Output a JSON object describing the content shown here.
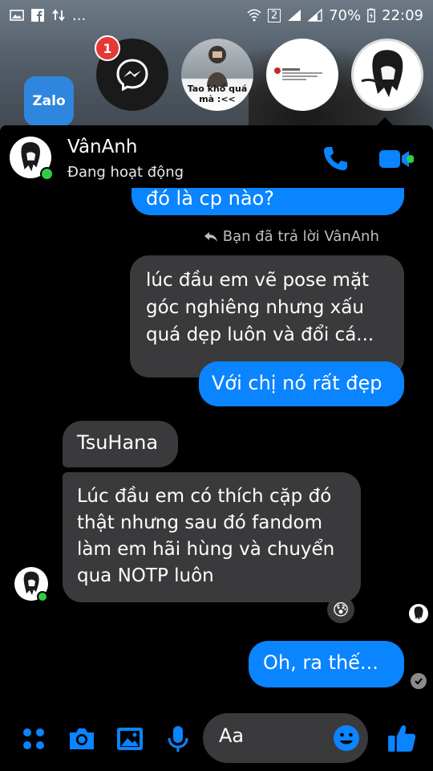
{
  "status_bar": {
    "battery": "70%",
    "time": "22:09",
    "sim_label": "2",
    "more": "..."
  },
  "home": {
    "zalo_label": "Zalo"
  },
  "chat_heads": {
    "badge_count": "1",
    "photo_caption": "Tao khổ quá mà :<<"
  },
  "chat": {
    "contact_name": "VânAnh",
    "contact_status": "Đang hoạt động",
    "reply_note": "Bạn đã trả lời VânAnh",
    "messages": [
      {
        "from": "me",
        "text": "đó là cp nào?"
      },
      {
        "from": "me",
        "quoted": true,
        "text": "lúc đầu em vẽ pose mặt góc nghiêng nhưng xấu quá dẹp luôn và đổi cá..."
      },
      {
        "from": "me",
        "text": "Với chị nó rất đẹp"
      },
      {
        "from": "them",
        "text": "TsuHana"
      },
      {
        "from": "them",
        "text": "Lúc đầu em có thích cặp đó thật nhưng sau đó fandom làm em hãi hùng và chuyển qua NOTP luôn",
        "reaction": "😰"
      },
      {
        "from": "me",
        "text": "Oh, ra thế..."
      }
    ]
  },
  "composer": {
    "placeholder": "Aa"
  },
  "colors": {
    "accent": "#0a84ff",
    "bubble_gray": "#3a3a3c",
    "online": "#31cc46",
    "badge": "#e53935"
  },
  "icons": [
    "messenger-icon",
    "phone-icon",
    "video-camera-icon",
    "apps-grid-icon",
    "camera-icon",
    "gallery-icon",
    "microphone-icon",
    "emoji-icon",
    "thumbs-up-icon",
    "reply-arrow-icon",
    "check-icon"
  ]
}
